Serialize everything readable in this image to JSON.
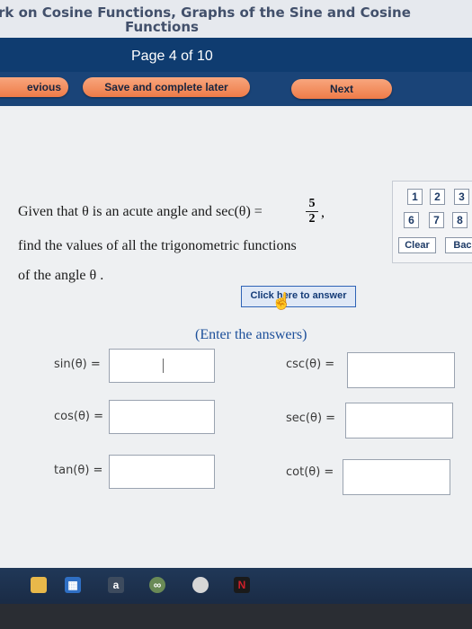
{
  "header": {
    "title_line1": "rk on Cosine Functions, Graphs of the Sine and Cosine",
    "title_line2": "Functions",
    "page_label": "Page 4 of 10"
  },
  "nav": {
    "previous_label": "evious",
    "save_label": "Save and complete later",
    "next_label": "Next"
  },
  "question": {
    "line1_text": "Given that θ is an acute angle and sec(θ) =",
    "fraction_numerator": "5",
    "fraction_denominator": "2",
    "comma": ",",
    "line2_text": "find the values of all the trigonometric functions",
    "line3_text": "of the angle θ ."
  },
  "keypad": {
    "keys": [
      "1",
      "2",
      "3",
      "6",
      "7",
      "8"
    ],
    "clear_label": "Clear",
    "back_label": "Bacl"
  },
  "answer_button_label": "Click here to answer",
  "enter_label": "(Enter the answers)",
  "fields": {
    "sin": {
      "label": "sin(θ) =",
      "value": ""
    },
    "csc": {
      "label": "csc(θ) =",
      "value": ""
    },
    "cos": {
      "label": "cos(θ) =",
      "value": ""
    },
    "sec": {
      "label": "sec(θ) =",
      "value": ""
    },
    "tan": {
      "label": "tan(θ) =",
      "value": ""
    },
    "cot": {
      "label": "cot(θ) =",
      "value": ""
    }
  },
  "taskbar": {
    "amazon_label": "a",
    "netflix_label": "N",
    "icons": [
      "file-explorer-icon",
      "store-icon",
      "amazon-icon",
      "tripadvisor-icon",
      "chrome-icon",
      "netflix-icon"
    ]
  },
  "colors": {
    "header_bg": "#0f3c70",
    "button_orange": "#ee7b48",
    "link_blue": "#1c4f9a"
  }
}
